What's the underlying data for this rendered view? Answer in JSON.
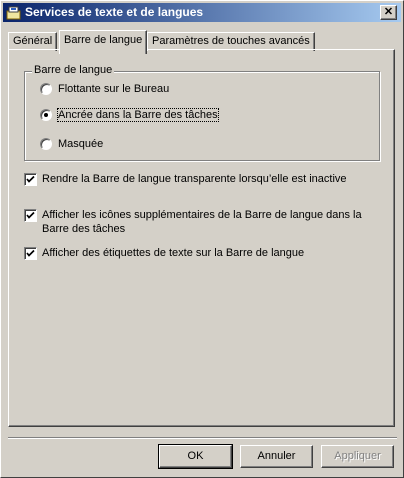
{
  "window": {
    "title": "Services de texte et de langues"
  },
  "tabs": [
    {
      "label": "Général"
    },
    {
      "label": "Barre de langue"
    },
    {
      "label": "Paramètres de touches avancés"
    }
  ],
  "group": {
    "label": "Barre de langue",
    "options": [
      {
        "label": "Flottante sur le Bureau",
        "selected": false
      },
      {
        "label": "Ancrée dans la Barre des tâches",
        "selected": true
      },
      {
        "label": "Masquée",
        "selected": false
      }
    ]
  },
  "checks": [
    {
      "label": "Rendre la Barre de langue transparente lorsqu’elle est inactive",
      "checked": true
    },
    {
      "line1": "Afficher les icônes supplémentaires de la Barre de langue dans la",
      "line2": "Barre des tâches",
      "checked": true
    },
    {
      "label": "Afficher des étiquettes de texte sur la Barre de langue",
      "checked": true
    }
  ],
  "buttons": {
    "ok": "OK",
    "cancel": "Annuler",
    "apply": "Appliquer"
  }
}
